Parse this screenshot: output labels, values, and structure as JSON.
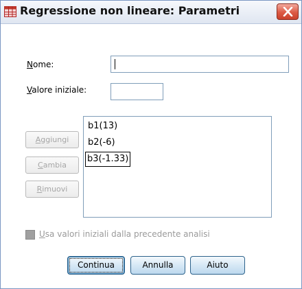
{
  "window": {
    "title": "Regressione non lineare: Parametri",
    "close_icon": "close-x-icon",
    "app_icon": "table-grid-icon"
  },
  "form": {
    "name_label_first": "N",
    "name_label_rest": "ome:",
    "name_value": "",
    "initial_label_first": "V",
    "initial_label_rest": "alore iniziale:",
    "initial_value": ""
  },
  "side_buttons": {
    "add_first": "A",
    "add_rest": "ggiungi",
    "change_first": "C",
    "change_rest": "ambia",
    "remove_first": "R",
    "remove_rest": "imuovi"
  },
  "parameters": [
    "b1(13)",
    "b2(-6)",
    "b3(-1.33)"
  ],
  "checkbox": {
    "label_first": "U",
    "label_rest": "sa valori iniziali dalla precedente analisi",
    "checked": false,
    "enabled": false
  },
  "buttons": {
    "continue_label": "Continua",
    "cancel_label": "Annulla",
    "help_label": "Aiuto"
  },
  "colors": {
    "close_button": "#dc5a45",
    "button_border": "#2c628b",
    "field_border": "#7f9db9"
  }
}
